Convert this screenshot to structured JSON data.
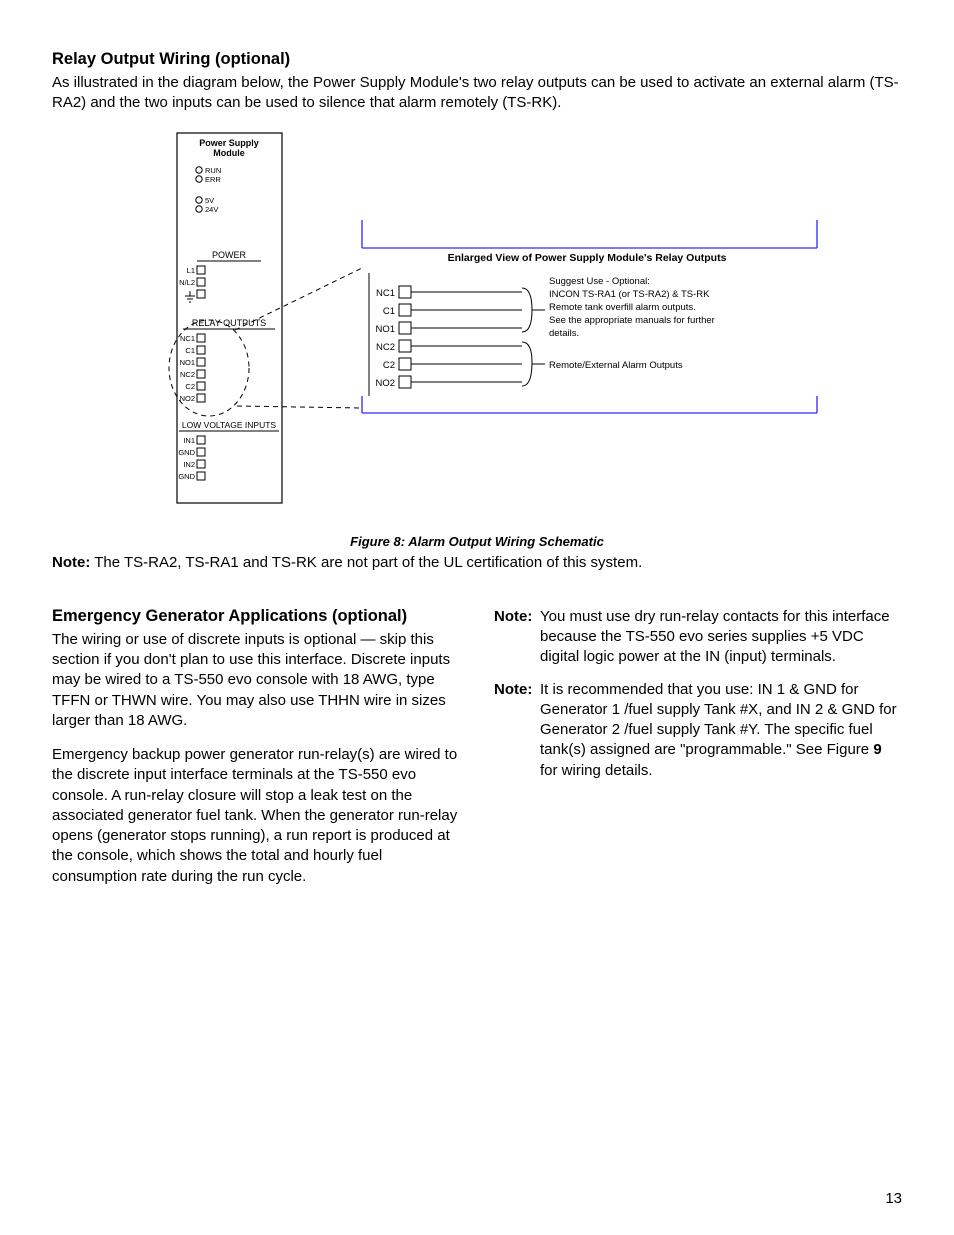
{
  "page_number": "13",
  "sec1": {
    "heading": "Relay Output Wiring (optional)",
    "para": "As illustrated in the diagram below, the Power Supply Module's two relay outputs can be used to activate an external alarm (TS-RA2) and the two inputs can be used to silence that alarm remotely (TS-RK).",
    "fig_caption": "Figure 8: Alarm Output Wiring Schematic",
    "note_label": "Note:",
    "note_text": "  The TS-RA2, TS-RA1 and TS-RK are not part of the UL certification of this system."
  },
  "diagram": {
    "module_title1": "Power Supply",
    "module_title2": "Module",
    "led_run": "RUN",
    "led_err": "ERR",
    "led_5v": "5V",
    "led_24v": "24V",
    "sec_power": "POWER",
    "p_l1": "L1",
    "p_nl2": "N/L2",
    "sec_relay": "RELAY OUTPUTS",
    "r_nc1": "NC1",
    "r_c1": "C1",
    "r_no1": "NO1",
    "r_nc2": "NC2",
    "r_c2": "C2",
    "r_no2": "NO2",
    "sec_low": "LOW VOLTAGE INPUTS",
    "lv_in1": "IN1",
    "lv_gnd": "GND",
    "lv_in2": "IN2",
    "enlarged_title": "Enlarged View of Power Supply Module's Relay Outputs",
    "e_nc1": "NC1",
    "e_c1": "C1",
    "e_no1": "NO1",
    "e_nc2": "NC2",
    "e_c2": "C2",
    "e_no2": "NO2",
    "suggest_l1": "Suggest Use - Optional:",
    "suggest_l2": "INCON TS-RA1 (or TS-RA2) & TS-RK",
    "suggest_l3": "Remote tank overfill alarm outputs.",
    "suggest_l4": "See the appropriate manuals for further",
    "suggest_l5": "details.",
    "remote_label": "Remote/External Alarm Outputs"
  },
  "sec2": {
    "heading": "Emergency Generator Applications (optional)",
    "para1": "The wiring or use of discrete inputs is optional — skip this section if you don't plan to use this interface. Discrete inputs may be wired to a TS-550 evo console with 18 AWG, type TFFN or THWN wire. You may also use THHN wire in sizes larger than 18 AWG.",
    "para2": "Emergency backup power generator run-relay(s) are wired to the discrete input interface terminals at the TS-550 evo console. A run-relay closure will stop a leak test on the associated generator fuel tank. When the generator run-relay opens (generator stops running), a run report is produced at the console, which shows the total and hourly fuel consumption rate during the run cycle.",
    "note1_label": "Note:",
    "note1_text": "You must use dry run-relay contacts for this interface because the TS-550 evo series supplies +5 VDC digital logic power at the IN (input) terminals.",
    "note2_label": "Note:",
    "note2_text_a": "It is recommended that you use: IN 1 & GND for Generator 1 /fuel supply Tank #X, and IN 2 & GND for Generator 2 /fuel supply Tank #Y. The specific fuel tank(s) assigned are \"programmable.\" See Figure ",
    "note2_text_bold": "9",
    "note2_text_b": " for wiring details."
  }
}
